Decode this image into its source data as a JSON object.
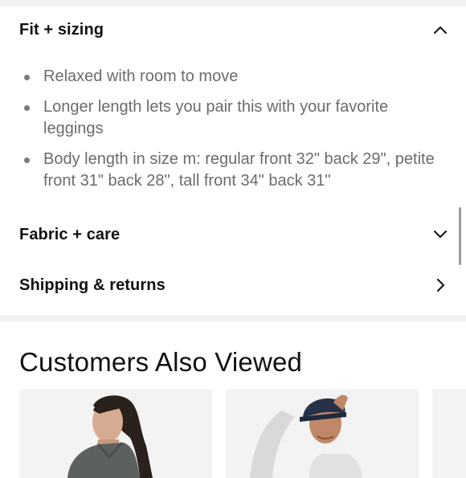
{
  "accordions": [
    {
      "title": "Fit + sizing",
      "state": "expanded",
      "icon": "chevron-up-icon"
    },
    {
      "title": "Fabric + care",
      "state": "collapsed",
      "icon": "chevron-down-icon"
    },
    {
      "title": "Shipping & returns",
      "state": "link",
      "icon": "chevron-right-icon"
    }
  ],
  "fit_details": [
    "Relaxed with room to move",
    "Longer length lets you pair this with your favorite leggings",
    "Body length in size m: regular front 32\" back 29\", petite front 31\" back 28\", tall front 34\" back 31\""
  ],
  "customers_also_viewed": {
    "title": "Customers Also Viewed",
    "products": [
      {
        "image": "woman-grey-sweatshirt-photo"
      },
      {
        "image": "woman-navy-cap-photo"
      },
      {
        "image": "partial-product-photo"
      }
    ]
  },
  "colors": {
    "text": "#111111",
    "muted_text": "#6b6b6b",
    "divider": "#f0f0f0"
  }
}
